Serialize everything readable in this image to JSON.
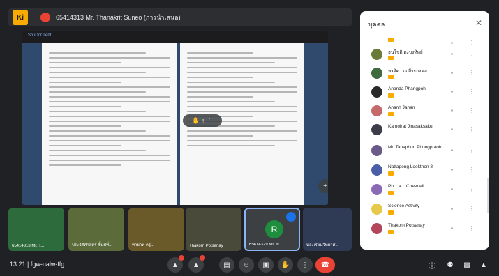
{
  "header": {
    "logo": "Ki",
    "presenting": "65414313 Mr. Thanakrit Suneo (การนำเสนอ)"
  },
  "screen": {
    "bar_text": "Sh iDoClient",
    "ctrl_icons": "✋ ↑ ⋮",
    "zoom_icon": "+"
  },
  "tiles": [
    {
      "name": "65414313 Mr. T...",
      "type": "video"
    },
    {
      "name": "ประวัติศาสตร์ ชั้นปีที่...",
      "type": "video"
    },
    {
      "name": "ทายาท ครู...",
      "type": "video"
    },
    {
      "name": "Thakorn Potsanay",
      "type": "video"
    },
    {
      "name": "65414329 Mr. N...",
      "type": "avatar",
      "initial": "R"
    },
    {
      "name": "ห้องเรียนวิทยาศ...",
      "type": "video"
    }
  ],
  "toolbar": {
    "time": "13:21",
    "code": "fgw-ualw-ffg",
    "end_icon": "☎"
  },
  "people": {
    "title": "บุคคล",
    "close": "✕",
    "list": [
      {
        "name": "ธนโชติ ตะบงทิพย์"
      },
      {
        "name": "พรจิดา ณ ถีระมงคล"
      },
      {
        "name": "Ananda Phangpoh"
      },
      {
        "name": "Ananh Jahan"
      },
      {
        "name": "Kamolrat Jinasaksakul"
      },
      {
        "name": "Mr. Tanaphon Phongpraoh"
      },
      {
        "name": "Nattapong Lookthon 8"
      },
      {
        "name": "Ph... a... Cheenell"
      },
      {
        "name": "Science Activity"
      },
      {
        "name": "Thakorn Potsanay"
      }
    ]
  },
  "colors": {
    "accent": "#8ab4f8",
    "end": "#ea4335",
    "tag": "#f9ab00"
  }
}
